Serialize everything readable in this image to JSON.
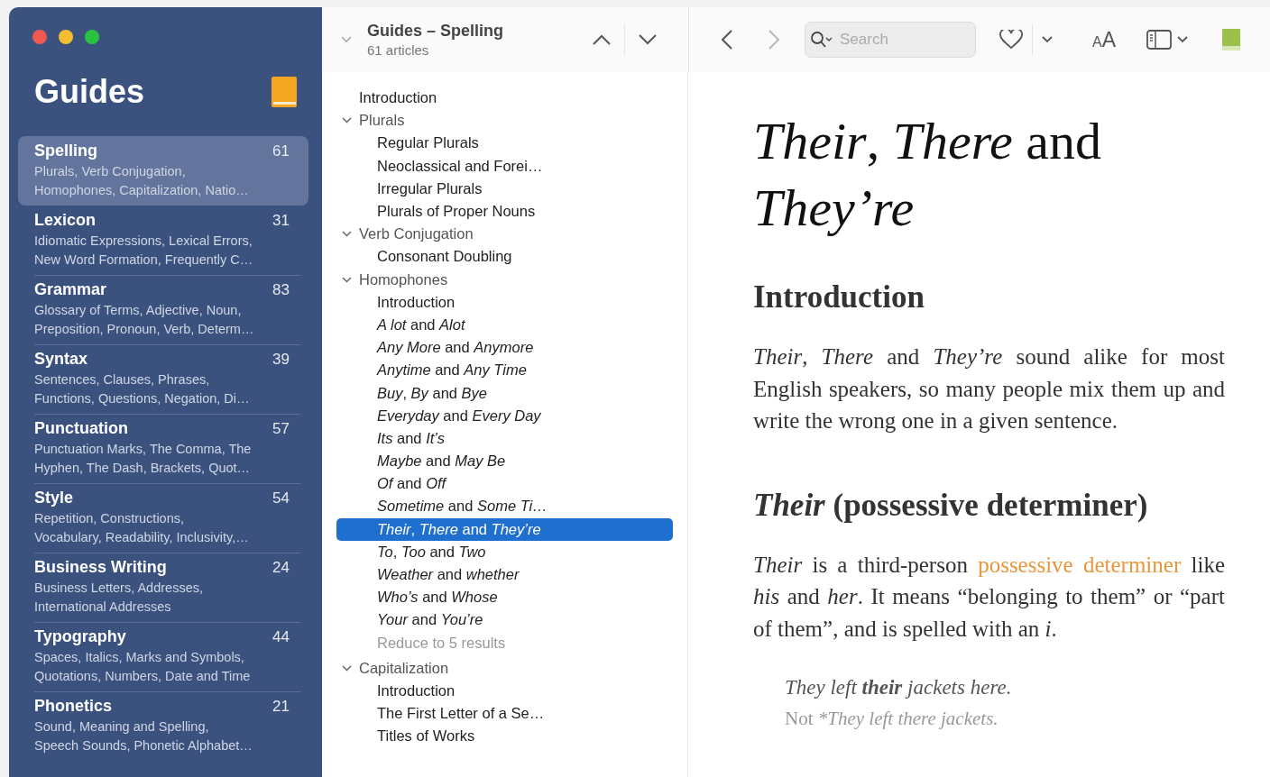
{
  "sidebar": {
    "title": "Guides",
    "items": [
      {
        "name": "Spelling",
        "count": "61",
        "summary": [
          "Plurals, Verb Conjugation,",
          "Homophones, Capitalization, Natio…"
        ],
        "selected": true
      },
      {
        "name": "Lexicon",
        "count": "31",
        "summary": [
          "Idiomatic Expressions, Lexical Errors,",
          "New Word Formation, Frequently C…"
        ],
        "selected": false
      },
      {
        "name": "Grammar",
        "count": "83",
        "summary": [
          "Glossary of Terms, Adjective, Noun,",
          "Preposition, Pronoun, Verb, Determ…"
        ],
        "selected": false
      },
      {
        "name": "Syntax",
        "count": "39",
        "summary": [
          "Sentences, Clauses, Phrases,",
          "Functions, Questions, Negation, Di…"
        ],
        "selected": false
      },
      {
        "name": "Punctuation",
        "count": "57",
        "summary": [
          "Punctuation Marks, The Comma, The",
          "Hyphen, The Dash, Brackets, Quot…"
        ],
        "selected": false
      },
      {
        "name": "Style",
        "count": "54",
        "summary": [
          "Repetition, Constructions,",
          "Vocabulary, Readability, Inclusivity,…"
        ],
        "selected": false
      },
      {
        "name": "Business Writing",
        "count": "24",
        "summary": [
          "Business Letters, Addresses,",
          "International Addresses"
        ],
        "selected": false
      },
      {
        "name": "Typography",
        "count": "44",
        "summary": [
          "Spaces, Italics, Marks and Symbols,",
          "Quotations, Numbers, Date and Time"
        ],
        "selected": false
      },
      {
        "name": "Phonetics",
        "count": "21",
        "summary": [
          "Sound, Meaning and Spelling,",
          "Speech Sounds, Phonetic Alphabet…"
        ],
        "selected": false
      }
    ]
  },
  "toolbar": {
    "title": "Guides – Spelling",
    "subtitle": "61 articles",
    "back_disabled": false,
    "forward_disabled": true,
    "search": {
      "placeholder": "Search"
    },
    "text_size_letters": [
      "A",
      "A"
    ]
  },
  "tree": [
    {
      "label": "Introduction",
      "selected": false
    },
    {
      "label": "Plurals",
      "expanded": true,
      "selected": false,
      "children": [
        {
          "label": "Regular Plurals",
          "kind": "article",
          "selected": false
        },
        {
          "label": "Neoclassical and Forei…",
          "kind": "article",
          "selected": false
        },
        {
          "label": "Irregular Plurals",
          "kind": "article",
          "selected": false
        },
        {
          "label": "Plurals of Proper Nouns",
          "kind": "article",
          "selected": false
        }
      ]
    },
    {
      "label": "Verb Conjugation",
      "expanded": true,
      "selected": false,
      "children": [
        {
          "label": "Consonant Doubling",
          "kind": "article",
          "selected": false
        }
      ]
    },
    {
      "label": "Homophones",
      "expanded": true,
      "selected": false,
      "children": [
        {
          "label": "Introduction",
          "kind": "article",
          "selected": false
        },
        {
          "label": "*A lot* and *Alot*",
          "kind": "article",
          "selected": false
        },
        {
          "label": "*Any More* and *Anymore*",
          "kind": "article",
          "selected": false
        },
        {
          "label": "*Anytime* and *Any Time*",
          "kind": "article",
          "selected": false
        },
        {
          "label": "*Buy*, *By* and *Bye*",
          "kind": "article",
          "selected": false
        },
        {
          "label": "*Everyday* and *Every Day*",
          "kind": "article",
          "selected": false
        },
        {
          "label": "*Its* and *It’s*",
          "kind": "article",
          "selected": false
        },
        {
          "label": "*Maybe* and *May Be*",
          "kind": "article",
          "selected": false
        },
        {
          "label": "*Of* and *Off*",
          "kind": "article",
          "selected": false
        },
        {
          "label": "*Sometime* and *Some Ti…*",
          "kind": "article",
          "selected": false
        },
        {
          "label": "*Their*, *There* and *They’re*",
          "kind": "article",
          "selected": true
        },
        {
          "label": "*To*, *Too* and *Two*",
          "kind": "article",
          "selected": false
        },
        {
          "label": "*Weather* and *whether*",
          "kind": "article",
          "selected": false
        },
        {
          "label": "*Who’s* and *Whose*",
          "kind": "article",
          "selected": false
        },
        {
          "label": "*Your* and *You’re*",
          "kind": "article",
          "selected": false
        },
        {
          "label": "Reduce to 5 results",
          "kind": "more",
          "selected": false
        }
      ]
    },
    {
      "label": "Capitalization",
      "expanded": true,
      "selected": false,
      "children": [
        {
          "label": "Introduction",
          "kind": "article",
          "selected": false
        },
        {
          "label": "The First Letter of a Se…",
          "kind": "article",
          "selected": false
        },
        {
          "label": "Titles of Works",
          "kind": "article",
          "selected": false
        }
      ]
    }
  ],
  "article": {
    "title": "*Their*, *There* and *They’re*",
    "sections": [
      {
        "kind": "heading",
        "text": "Introduction"
      },
      {
        "kind": "paragraph",
        "parts": [
          {
            "kind": "text",
            "text": "*Their*, *There* and *They’re* sound alike for most English speakers, so many people mix them up and write the wrong one in a given sentence."
          }
        ]
      },
      {
        "kind": "heading",
        "text": "*Their* (possessive determiner)"
      },
      {
        "kind": "paragraph",
        "parts": [
          {
            "kind": "text",
            "text": "*Their* is a third-person "
          },
          {
            "kind": "link",
            "text": "possessive determiner"
          },
          {
            "kind": "text",
            "text": " like *his* and *her*. It means “belonging to them” or “part of them”, and is spelled with an *i*."
          }
        ]
      },
      {
        "kind": "example",
        "lines": [
          {
            "kind": "correct",
            "text": "They left **their** jackets here."
          },
          {
            "kind": "incorrect",
            "prefix": "Not",
            "text": "*They left there jackets."
          }
        ]
      }
    ]
  }
}
